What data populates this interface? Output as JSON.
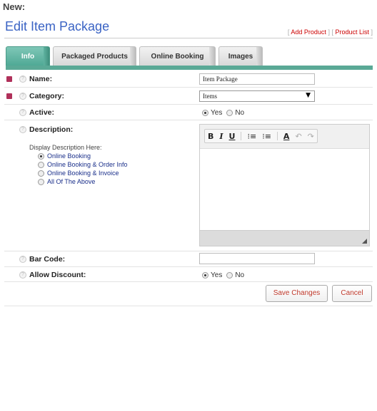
{
  "top_label": "New:",
  "page_title": "Edit Item Package",
  "header_links": {
    "add_product": "Add Product",
    "product_list": "Product List"
  },
  "tabs": [
    {
      "label": "Info",
      "active": true
    },
    {
      "label": "Packaged Products",
      "active": false
    },
    {
      "label": "Online Booking",
      "active": false
    },
    {
      "label": "Images",
      "active": false
    }
  ],
  "fields": {
    "name": {
      "label": "Name:",
      "value": "Item Package"
    },
    "category": {
      "label": "Category:",
      "value": "Items"
    },
    "active": {
      "label": "Active:",
      "yes": "Yes",
      "no": "No",
      "selected": "Yes"
    },
    "description": {
      "label": "Description:",
      "display_heading": "Display Description Here:",
      "options": [
        "Online Booking",
        "Online Booking & Order Info",
        "Online Booking & Invoice",
        "All Of The Above"
      ],
      "selected": "Online Booking"
    },
    "bar_code": {
      "label": "Bar Code:",
      "value": ""
    },
    "allow_discount": {
      "label": "Allow Discount:",
      "yes": "Yes",
      "no": "No",
      "selected": "Yes"
    }
  },
  "editor_toolbar": {
    "bold": "B",
    "italic": "I",
    "underline": "U",
    "ordered_list": "⁝≡",
    "bullet_list": "⁝≡",
    "font_color": "A",
    "undo": "↶",
    "redo": "↷"
  },
  "buttons": {
    "save": "Save Changes",
    "cancel": "Cancel"
  },
  "colors": {
    "accent_title": "#3a63c4",
    "active_tab": "#5aa996",
    "required": "#b0305a",
    "link": "#cc0000"
  }
}
